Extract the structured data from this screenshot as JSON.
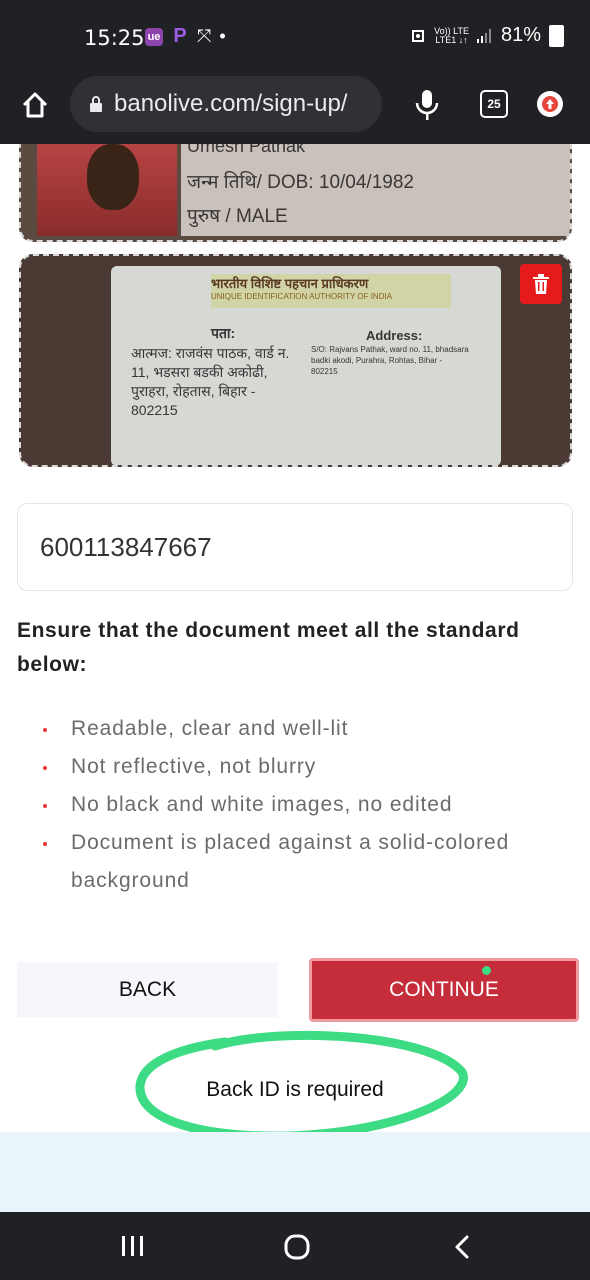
{
  "status_bar": {
    "time": "15:25",
    "network_top": "Vo)) LTE",
    "network_bottom": "LTE1 ↓↑",
    "battery": "81%",
    "icons": [
      "app-icon-ue",
      "picsart-icon",
      "missed-call-icon",
      "dot-icon",
      "screenshot-icon",
      "signal-icon",
      "battery-icon"
    ]
  },
  "browser": {
    "url": "banolive.com/sign-up/",
    "tabs_count": "25",
    "icons": [
      "home-icon",
      "lock-icon",
      "mic-icon",
      "tabs-icon",
      "update-icon"
    ]
  },
  "front_card": {
    "name": "Umesh Pathak",
    "dob": "जन्म तिथि/ DOB: 10/04/1982",
    "gender": "पुरुष  / MALE"
  },
  "back_card": {
    "header_hindi": "भारतीय विशिष्ट पहचान प्राधिकरण",
    "header_english": "UNIQUE IDENTIFICATION AUTHORITY OF INDIA",
    "address_label_hindi": "पता:",
    "address_hindi": "आत्मज: राजवंस पाठक, वार्ड न. 11, भडसरा बडकी अकोढी, पुराहरा, रोहतास, बिहार - 802215",
    "address_label_english": "Address:",
    "address_english": "S/O: Rajvans Pathak, ward no. 11, bhadsara badki akodi, Purahra, Rohtas, Bihar - 802215",
    "delete_icon": "trash-icon"
  },
  "form": {
    "id_number": "600113847667",
    "instruction": "Ensure that the document meet all the standard below:",
    "requirements": [
      "Readable, clear and well-lit",
      "Not reflective, not blurry",
      "No black and white images, no edited",
      "Document is placed against a solid-colored background"
    ],
    "back_label": "BACK",
    "continue_label": "CONTINUE",
    "error": "Back ID is required"
  },
  "colors": {
    "primary": "#c52d3b",
    "bullet": "#e53935",
    "annotation": "#3ddc84",
    "system_bar": "#202124"
  },
  "nav_icons": [
    "recent-apps-icon",
    "home-circle-icon",
    "back-arrow-icon"
  ]
}
